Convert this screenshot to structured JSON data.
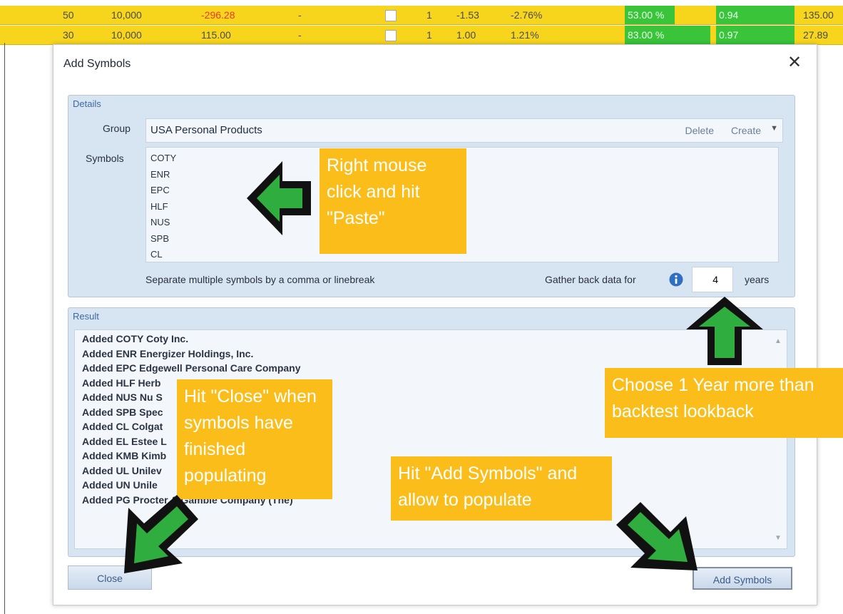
{
  "background": {
    "rows": [
      [
        "50",
        "10,000",
        "-296.28",
        "-",
        "1",
        "-1.53",
        "-2.76%",
        "53.00 %",
        "0.94",
        "135.00"
      ],
      [
        "30",
        "10,000",
        "115.00",
        "-",
        "1",
        "1.00",
        "1.21%",
        "83.00 %",
        "0.97",
        "27.89"
      ]
    ]
  },
  "dialog": {
    "title": "Add Symbols",
    "close_glyph": "✕",
    "details": {
      "heading": "Details",
      "group_label": "Group",
      "group_value": "USA Personal Products",
      "delete_label": "Delete",
      "create_label": "Create",
      "caret": "▼",
      "symbols_label": "Symbols",
      "symbols": [
        "COTY",
        "ENR",
        "EPC",
        "HLF",
        "NUS",
        "SPB",
        "CL"
      ],
      "hint": "Separate multiple symbols by a comma or linebreak",
      "gather_label": "Gather back data for",
      "years_value": "4",
      "years_label": "years"
    },
    "result": {
      "heading": "Result",
      "lines": [
        "Added COTY Coty Inc.",
        "Added ENR Energizer Holdings, Inc.",
        "Added EPC Edgewell Personal Care Company",
        "Added HLF Herb",
        "Added NUS Nu S",
        "Added SPB Spec",
        "Added CL Colgat",
        "Added EL Estee L",
        "Added KMB Kimb",
        "Added UL Unilev",
        "Added UN Unile",
        "Added PG Procter & Gamble Company (The)"
      ]
    },
    "buttons": {
      "close": "Close",
      "add": "Add Symbols"
    }
  },
  "annotations": {
    "paste": "Right mouse click and hit \"Paste\"",
    "close": "Hit \"Close\" when symbols have finished populating",
    "add": "Hit \"Add Symbols\" and allow to populate",
    "years": "Choose 1 Year more than backtest lookback"
  },
  "colors": {
    "row_bg": "#f7d51d",
    "panel_bg": "#d7e4f2",
    "callout_bg": "#fbbd1a",
    "arrow_fill": "#2fae3f"
  }
}
